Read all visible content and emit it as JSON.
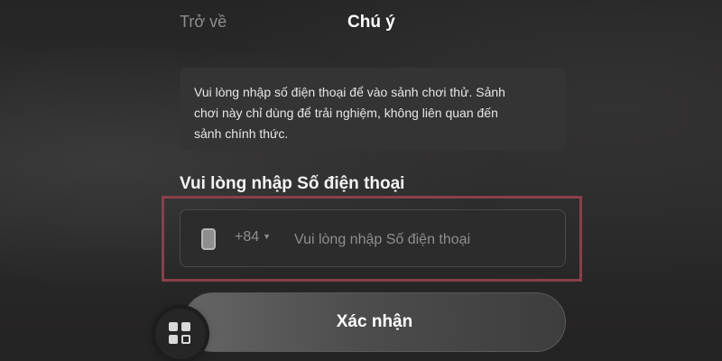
{
  "header": {
    "back_label": "Trở về",
    "title": "Chú ý"
  },
  "notice": {
    "line1": "Vui lòng nhập số điện thoại để vào sảnh chơi thử. Sảnh",
    "line2": "chơi này chỉ dùng để trải nghiệm, không liên quan đến",
    "line3": "sảnh chính thức."
  },
  "phone_form": {
    "label": "Vui lòng nhập Số điện thoại",
    "country_code": "+84",
    "input_value": "",
    "placeholder": "Vui lòng nhập Số điện thoại",
    "submit_label": "Xác nhận"
  },
  "icons": {
    "phone": "phone-icon",
    "dropdown": "caret-down-icon",
    "apps": "app-grid-icon"
  },
  "colors": {
    "highlight_border": "#8a3f4b",
    "background": "#2a2929"
  }
}
